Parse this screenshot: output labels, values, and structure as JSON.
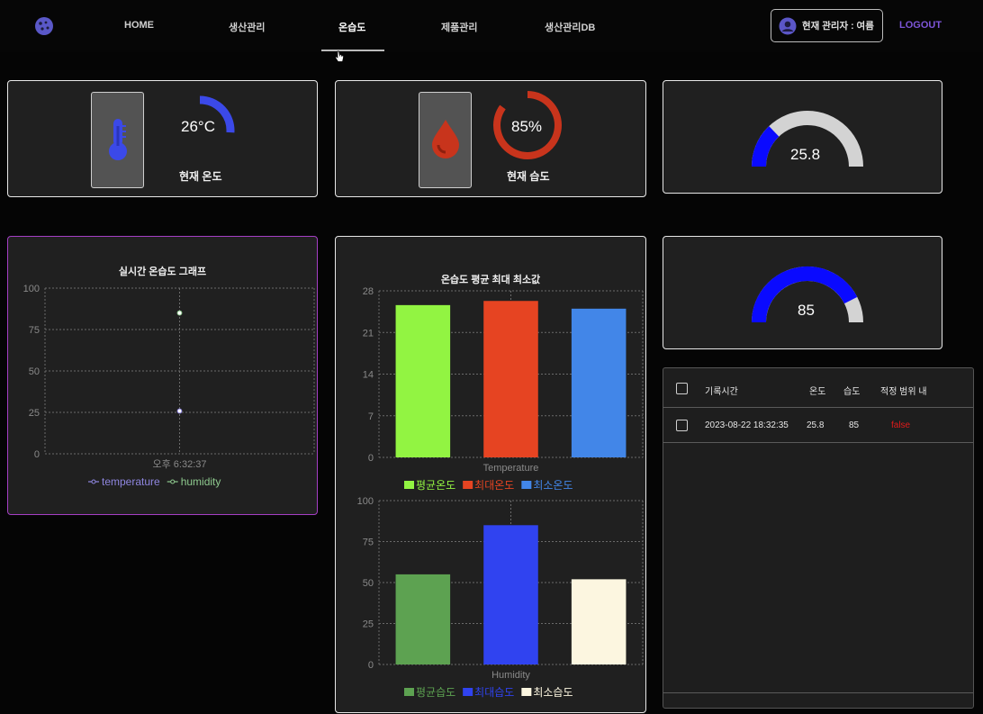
{
  "nav": {
    "items": [
      "HOME",
      "생산관리",
      "온습도",
      "제품관리",
      "생산관리DB"
    ],
    "active_index": 2,
    "admin_label": "현재 관리자 : 여름",
    "logout_label": "LOGOUT",
    "icons": {
      "logo": "cookie-icon",
      "avatar": "user-avatar-icon",
      "cursor": "hand-pointer-icon"
    }
  },
  "temp_card": {
    "value_text": "26°C",
    "label": "현재 온도",
    "gauge_fraction": 0.26,
    "color": "#3b49e8",
    "icon": "thermometer-icon"
  },
  "humid_card": {
    "value_text": "85%",
    "label": "현재 습도",
    "gauge_fraction": 0.85,
    "color": "#c8341c",
    "icon": "water-drop-icon"
  },
  "gauge_temp": {
    "value_text": "25.8",
    "value": 25.8,
    "max": 100,
    "fill_color": "#0a0aff",
    "track_color": "#d3d3d3"
  },
  "gauge_humid": {
    "value_text": "85",
    "value": 85,
    "max": 100,
    "fill_color": "#0a0aff",
    "track_color": "#d3d3d3"
  },
  "chart_data": [
    {
      "type": "scatter",
      "title": "실시간 온습도 그래프",
      "ylim": [
        0,
        100
      ],
      "yticks": [
        "0",
        "25",
        "50",
        "75",
        "100"
      ],
      "x": [
        "오후 6:32:37"
      ],
      "grid": true,
      "legend": "bottom",
      "series": [
        {
          "name": "temperature",
          "values": [
            25.8
          ],
          "color": "#8f86e0"
        },
        {
          "name": "humidity",
          "values": [
            85
          ],
          "color": "#8ec98e"
        }
      ]
    },
    {
      "type": "bar",
      "title": "온습도 평균 최대 최소값",
      "xlabel": "Temperature",
      "ylim": [
        0,
        28
      ],
      "yticks": [
        "0",
        "7",
        "14",
        "21",
        "28"
      ],
      "categories": [
        "평균온도",
        "최대온도",
        "최소온도"
      ],
      "values": [
        25.6,
        26.3,
        25
      ],
      "colors": [
        "#92f442",
        "#e64422",
        "#4286e8"
      ],
      "grid": true,
      "legend": "bottom"
    },
    {
      "type": "bar",
      "xlabel": "Humidity",
      "ylim": [
        0,
        100
      ],
      "yticks": [
        "0",
        "25",
        "50",
        "75",
        "100"
      ],
      "categories": [
        "평균습도",
        "최대습도",
        "최소습도"
      ],
      "values": [
        55,
        85,
        52
      ],
      "colors": [
        "#5da251",
        "#3043f0",
        "#fcf6e0"
      ],
      "grid": true,
      "legend": "bottom"
    }
  ],
  "table": {
    "headers": [
      "기록시간",
      "온도",
      "습도",
      "적정 범위 내"
    ],
    "rows": [
      {
        "time": "2023-08-22 18:32:35",
        "temp": "25.8",
        "humid": "85",
        "in_range": "false"
      }
    ],
    "false_color": "#e01b1b"
  }
}
